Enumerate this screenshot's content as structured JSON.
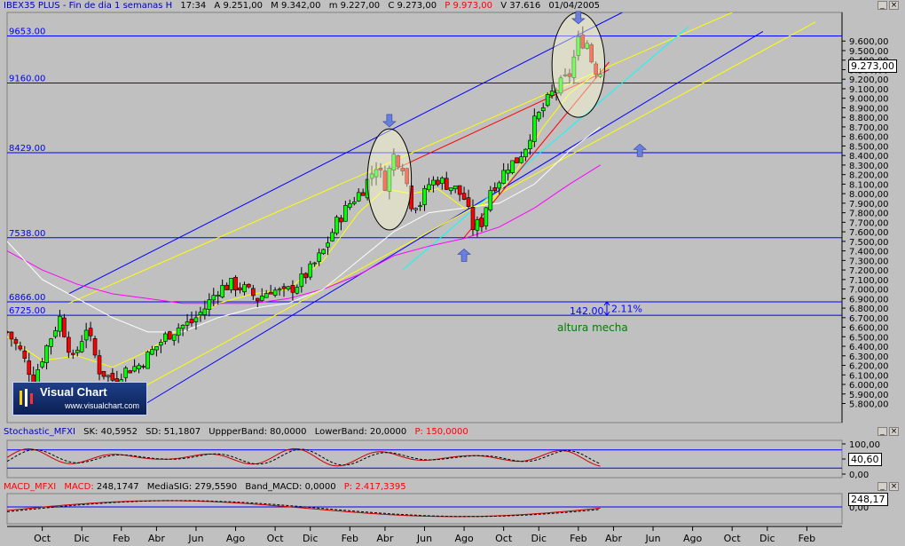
{
  "main": {
    "header": {
      "name": "IBEX35 PLUS - Fin de dia 1 semanas H",
      "time": "17:34",
      "a_label": "A",
      "a_value": "9.251,00",
      "m_label": "M",
      "m_value": "9.342,00",
      "m2_label": "m",
      "m2_value": "9.227,00",
      "c_label": "C",
      "c_value": "9.273,00",
      "p_label": "P",
      "p_value": "9.973,00",
      "v_label": "V",
      "v_value": "37.616",
      "date": "01/04/2005"
    },
    "last_value": "9.273,00",
    "levels": [
      {
        "label": "9653.00",
        "value": 9653
      },
      {
        "label": "9160.00",
        "value": 9160
      },
      {
        "label": "8429.00",
        "value": 8429
      },
      {
        "label": "7538.00",
        "value": 7538
      },
      {
        "label": "6866.00",
        "value": 6866
      },
      {
        "label": "6725.00",
        "value": 6725
      }
    ],
    "annotations": {
      "diff_value": "142.00",
      "diff_pct": "2.11%",
      "wick_label": "altura mecha"
    }
  },
  "logo": {
    "brand": "Visual Chart",
    "url": "www.visualchart.com"
  },
  "stochastic": {
    "name": "Stochastic_MFXI",
    "sk_label": "SK:",
    "sk_value": "40,5952",
    "sd_label": "SD:",
    "sd_value": "51,1807",
    "upper_label": "UppperBand:",
    "upper_value": "80,0000",
    "lower_label": "LowerBand:",
    "lower_value": "20,0000",
    "p_label": "P:",
    "p_value": "150,0000",
    "last_value": "40,60",
    "ticks": [
      "100,00",
      "50,00",
      "0,00"
    ]
  },
  "macd": {
    "name": "MACD_MFXI",
    "macd_label": "MACD:",
    "macd_value": "248,1747",
    "sig_label": "MediaSIG:",
    "sig_value": "279,5590",
    "band_label": "Band_MACD:",
    "band_value": "0,0000",
    "p_label": "P:",
    "p_value": "2.417,3395",
    "last_value": "248,17",
    "ticks": [
      "0,00"
    ]
  },
  "colors": {
    "background": "#c0c0c0",
    "bull_candle": "#00ff00",
    "bear_candle": "#ff0000",
    "level_line": "#0000ff",
    "channel": "#0000ff",
    "channel_yellow": "#ffff00",
    "ma_short": "#ffff00",
    "ma_mid": "#ffffff",
    "ma_long": "#ff00ff",
    "trend_cyan": "#00ffff",
    "trend_red": "#ff0000",
    "stoch_line": "#cc0000",
    "macd_line": "#cc0000",
    "signal_line": "#000000"
  },
  "chart_data": {
    "type": "candlestick",
    "price_axis": {
      "ticks": [
        "9.600,00",
        "9.500,00",
        "9.400,00",
        "9.300,00",
        "9.200,00",
        "9.100,00",
        "9.000,00",
        "8.900,00",
        "8.800,00",
        "8.700,00",
        "8.600,00",
        "8.500,00",
        "8.400,00",
        "8.300,00",
        "8.200,00",
        "8.100,00",
        "8.000,00",
        "7.900,00",
        "7.800,00",
        "7.700,00",
        "7.600,00",
        "7.500,00",
        "7.400,00",
        "7.300,00",
        "7.200,00",
        "7.100,00",
        "7.000,00",
        "6.900,00",
        "6.800,00",
        "6.700,00",
        "6.600,00",
        "6.500,00",
        "6.400,00",
        "6.300,00",
        "6.200,00",
        "6.100,00",
        "6.000,00",
        "5.900,00",
        "5.800,00"
      ],
      "tick_values": [
        9600,
        9500,
        9400,
        9300,
        9200,
        9100,
        9000,
        8900,
        8800,
        8700,
        8600,
        8500,
        8400,
        8300,
        8200,
        8100,
        8000,
        7900,
        7800,
        7700,
        7600,
        7500,
        7400,
        7300,
        7200,
        7100,
        7000,
        6900,
        6800,
        6700,
        6600,
        6500,
        6400,
        6300,
        6200,
        6100,
        6000,
        5900,
        5800
      ],
      "range": [
        5600,
        9900
      ]
    },
    "time_axis": {
      "labels": [
        "Oct",
        "Dic",
        "Feb",
        "Abr",
        "Jun",
        "Ago",
        "Oct",
        "Dic",
        "Feb",
        "Abr",
        "Jun",
        "Ago",
        "Oct",
        "Dic",
        "Feb",
        "Abr",
        "Jun",
        "Ago",
        "Oct",
        "Dic",
        "Feb"
      ],
      "week_index": [
        8,
        17,
        26,
        34,
        43,
        52,
        61,
        69,
        78,
        86,
        95,
        104,
        113,
        121,
        130,
        138,
        147,
        156,
        165,
        173,
        182
      ]
    },
    "close_path": [
      [
        0,
        6550
      ],
      [
        3,
        6350
      ],
      [
        6,
        6050
      ],
      [
        9,
        6400
      ],
      [
        12,
        6700
      ],
      [
        15,
        6250
      ],
      [
        18,
        6600
      ],
      [
        21,
        6150
      ],
      [
        24,
        6050
      ],
      [
        27,
        6150
      ],
      [
        30,
        6200
      ],
      [
        33,
        6350
      ],
      [
        36,
        6500
      ],
      [
        39,
        6600
      ],
      [
        42,
        6650
      ],
      [
        45,
        6800
      ],
      [
        48,
        7000
      ],
      [
        51,
        7050
      ],
      [
        54,
        7000
      ],
      [
        57,
        6900
      ],
      [
        60,
        7000
      ],
      [
        63,
        6950
      ],
      [
        66,
        7050
      ],
      [
        69,
        7200
      ],
      [
        72,
        7400
      ],
      [
        75,
        7700
      ],
      [
        78,
        7900
      ],
      [
        81,
        8050
      ],
      [
        84,
        8300
      ],
      [
        86,
        8100
      ],
      [
        88,
        8400
      ],
      [
        90,
        8300
      ],
      [
        92,
        7900
      ],
      [
        94,
        7900
      ],
      [
        96,
        8100
      ],
      [
        98,
        8150
      ],
      [
        100,
        8100
      ],
      [
        102,
        8050
      ],
      [
        104,
        7950
      ],
      [
        106,
        7650
      ],
      [
        108,
        7700
      ],
      [
        110,
        8050
      ],
      [
        112,
        8150
      ],
      [
        114,
        8300
      ],
      [
        116,
        8350
      ],
      [
        118,
        8500
      ],
      [
        120,
        8750
      ],
      [
        122,
        8900
      ],
      [
        124,
        9050
      ],
      [
        126,
        9150
      ],
      [
        128,
        9250
      ],
      [
        130,
        9600
      ],
      [
        132,
        9580
      ],
      [
        133,
        9400
      ],
      [
        134,
        9300
      ],
      [
        135,
        9273
      ]
    ],
    "overlays": {
      "ma_short": [
        [
          0,
          6500
        ],
        [
          8,
          6250
        ],
        [
          16,
          6300
        ],
        [
          24,
          6180
        ],
        [
          32,
          6350
        ],
        [
          40,
          6600
        ],
        [
          48,
          6850
        ],
        [
          56,
          6950
        ],
        [
          64,
          7000
        ],
        [
          72,
          7300
        ],
        [
          80,
          7800
        ],
        [
          86,
          8050
        ],
        [
          92,
          8000
        ],
        [
          98,
          8050
        ],
        [
          104,
          7850
        ],
        [
          110,
          7900
        ],
        [
          116,
          8250
        ],
        [
          122,
          8700
        ],
        [
          128,
          9050
        ],
        [
          135,
          9300
        ]
      ],
      "ma_mid": [
        [
          0,
          7500
        ],
        [
          8,
          7100
        ],
        [
          16,
          6900
        ],
        [
          24,
          6700
        ],
        [
          32,
          6550
        ],
        [
          40,
          6550
        ],
        [
          48,
          6700
        ],
        [
          56,
          6800
        ],
        [
          64,
          6850
        ],
        [
          72,
          7000
        ],
        [
          80,
          7300
        ],
        [
          88,
          7600
        ],
        [
          96,
          7800
        ],
        [
          104,
          7850
        ],
        [
          112,
          7900
        ],
        [
          120,
          8100
        ],
        [
          128,
          8450
        ],
        [
          135,
          8700
        ]
      ],
      "ma_long": [
        [
          0,
          7400
        ],
        [
          8,
          7200
        ],
        [
          16,
          7050
        ],
        [
          24,
          6950
        ],
        [
          32,
          6900
        ],
        [
          40,
          6850
        ],
        [
          48,
          6850
        ],
        [
          56,
          6850
        ],
        [
          64,
          6900
        ],
        [
          72,
          7000
        ],
        [
          80,
          7150
        ],
        [
          88,
          7350
        ],
        [
          96,
          7450
        ],
        [
          104,
          7530
        ],
        [
          112,
          7650
        ],
        [
          120,
          7850
        ],
        [
          128,
          8100
        ],
        [
          135,
          8300
        ]
      ]
    },
    "trend_lines": [
      {
        "color": "channel",
        "points": [
          [
            14,
            6950
          ],
          [
            140,
            9900
          ]
        ]
      },
      {
        "color": "channel",
        "points": [
          [
            28,
            5700
          ],
          [
            172,
            9700
          ]
        ]
      },
      {
        "color": "channel_yellow",
        "points": [
          [
            14,
            6850
          ],
          [
            165,
            9900
          ]
        ]
      },
      {
        "color": "channel_yellow",
        "points": [
          [
            28,
            5900
          ],
          [
            184,
            9800
          ]
        ]
      },
      {
        "color": "trend_cyan",
        "points": [
          [
            90,
            7200
          ],
          [
            155,
            9750
          ]
        ]
      },
      {
        "color": "trend_red",
        "points": [
          [
            104,
            7540
          ],
          [
            137,
            9380
          ]
        ]
      },
      {
        "color": "trend_red",
        "points": [
          [
            88,
            8250
          ],
          [
            137,
            9300
          ]
        ]
      }
    ],
    "highlight_ellipses": [
      {
        "center": [
          87,
          8150
        ],
        "rx_weeks": 5,
        "ry_value": 530
      },
      {
        "center": [
          130,
          9350
        ],
        "rx_weeks": 6,
        "ry_value": 550
      }
    ],
    "arrows": [
      {
        "at": [
          87,
          8700
        ],
        "dir": "down"
      },
      {
        "at": [
          104,
          7420
        ],
        "dir": "up"
      },
      {
        "at": [
          130,
          9780
        ],
        "dir": "down"
      },
      {
        "at": [
          144,
          8520
        ],
        "dir": "up"
      }
    ],
    "stochastic_series": "oscillating 20-90",
    "macd_series": "slowly rising near zero",
    "visible_weeks": [
      0,
      190
    ]
  }
}
